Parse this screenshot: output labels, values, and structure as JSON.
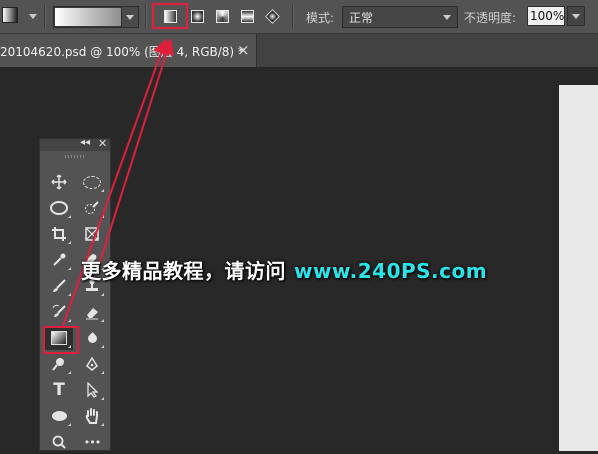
{
  "options_bar": {
    "tool_preset_icon": "gradient-tool-preset-icon",
    "gradient_picker": "gradient-swatch",
    "gradient_types": [
      "linear-gradient-icon",
      "radial-gradient-icon",
      "angle-gradient-icon",
      "reflected-gradient-icon",
      "diamond-gradient-icon"
    ],
    "mode_label": "模式:",
    "mode_value": "正常",
    "opacity_label": "不透明度:",
    "opacity_value": "100%"
  },
  "document_tab": {
    "title": "20104620.psd @ 100% (图层 4, RGB/8) *",
    "close": "×"
  },
  "tools_panel": {
    "collapse_glyph": "◂◂",
    "close_glyph": "✕",
    "tools": [
      "move-icon",
      "elliptical-marquee-icon",
      "lasso-icon",
      "quick-selection-icon",
      "crop-icon",
      "frame-icon",
      "eyedropper-icon",
      "spot-healing-icon",
      "brush-icon",
      "clone-stamp-icon",
      "history-brush-icon",
      "eraser-icon",
      "gradient-icon",
      "blur-icon",
      "dodge-icon",
      "pen-icon",
      "type-icon",
      "path-selection-icon",
      "ellipse-icon",
      "hand-icon",
      "zoom-icon",
      "more-icon"
    ],
    "type_glyph": "T",
    "more_glyph": "•••"
  },
  "watermark": {
    "text_cn": "更多精品教程，请访问",
    "url": "www.240PS.com"
  },
  "colors": {
    "highlight": "#e01f3d",
    "watermark_url": "#29e5ea",
    "canvas_bg": "#282828",
    "panel_bg": "#535353"
  }
}
